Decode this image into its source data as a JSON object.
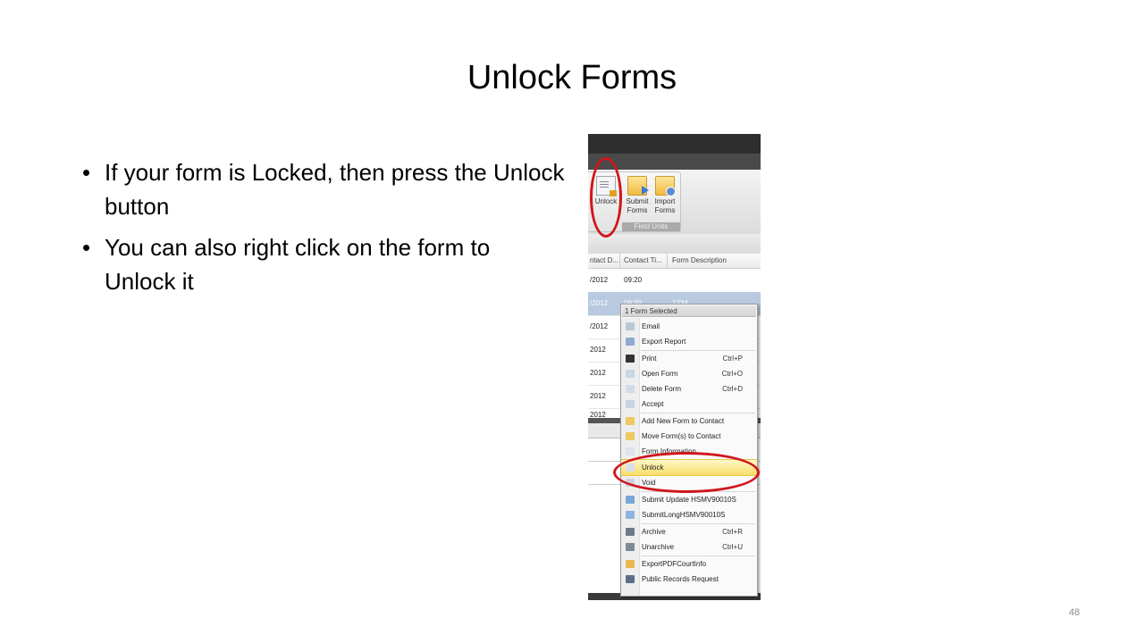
{
  "slide": {
    "title": "Unlock Forms",
    "bullets": [
      "If your form is Locked, then press the Unlock button",
      "You can also right click on the form to Unlock it"
    ],
    "bullet_glyph": "•",
    "page_number": "48"
  },
  "screenshot": {
    "ribbon": {
      "buttons": [
        {
          "label": "Unlock",
          "icon": "unlock-document-icon"
        },
        {
          "label_line1": "Submit",
          "label_line2": "Forms",
          "icon": "submit-folder-icon"
        },
        {
          "label_line1": "Import",
          "label_line2": "Forms",
          "icon": "import-folder-icon"
        }
      ],
      "group_label": "Field Units"
    },
    "grid": {
      "columns": [
        "ntact D...",
        "Contact Ti...",
        "Form Description"
      ],
      "rows": [
        {
          "date": "/2012",
          "time": "09:20",
          "desc": ""
        },
        {
          "date": "/2012",
          "time": "09:20",
          "desc": "1234",
          "selected": true
        },
        {
          "date": "/2012",
          "time": "",
          "desc": ""
        },
        {
          "date": "2012",
          "time": "",
          "desc": ""
        },
        {
          "date": "2012",
          "time": "",
          "desc": ""
        },
        {
          "date": "2012",
          "time": "",
          "desc": ""
        },
        {
          "date": "2012",
          "time": "",
          "desc": ""
        }
      ]
    },
    "context_menu": {
      "header": "1 Form Selected",
      "items": [
        {
          "label": "Email",
          "shortcut": "",
          "icon": "email-icon"
        },
        {
          "label": "Export Report",
          "shortcut": "",
          "icon": "export-report-icon"
        },
        {
          "label": "Print",
          "shortcut": "Ctrl+P",
          "icon": "printer-icon"
        },
        {
          "label": "Open Form",
          "shortcut": "Ctrl+O",
          "icon": "open-form-icon"
        },
        {
          "label": "Delete Form",
          "shortcut": "Ctrl+D",
          "icon": "delete-form-icon"
        },
        {
          "label": "Accept",
          "shortcut": "",
          "icon": "accept-icon"
        },
        {
          "label": "Add New Form to Contact",
          "shortcut": "",
          "icon": "add-form-folder-icon"
        },
        {
          "label": "Move Form(s) to Contact",
          "shortcut": "",
          "icon": "move-form-folder-icon"
        },
        {
          "label": "Form Information",
          "shortcut": "",
          "icon": "form-info-icon"
        },
        {
          "label": "Unlock",
          "shortcut": "",
          "icon": "unlock-icon",
          "highlighted": true
        },
        {
          "label": "Void",
          "shortcut": "",
          "icon": "void-icon"
        },
        {
          "label": "Submit Update HSMV90010S",
          "shortcut": "",
          "icon": "submit-update-icon"
        },
        {
          "label": "SubmitLongHSMV90010S",
          "shortcut": "",
          "icon": "submit-long-icon"
        },
        {
          "label": "Archive",
          "shortcut": "Ctrl+R",
          "icon": "archive-icon"
        },
        {
          "label": "Unarchive",
          "shortcut": "Ctrl+U",
          "icon": "unarchive-icon"
        },
        {
          "label": "ExportPDFCourtInfo",
          "shortcut": "",
          "icon": "export-pdf-icon"
        },
        {
          "label": "Public Records Request",
          "shortcut": "",
          "icon": "public-records-icon"
        }
      ]
    },
    "annotation_color": "#d0161c",
    "highlight_color": "#f7de6a",
    "selection_color": "#b8c9e0"
  }
}
